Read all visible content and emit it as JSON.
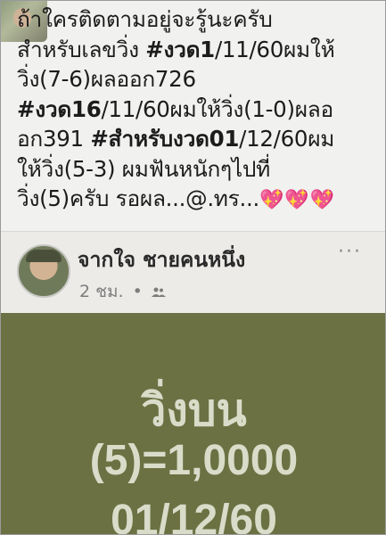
{
  "post": {
    "lines": [
      "ถ้าใครติดตามอยู่จะรู้นะครับ",
      "สำหรับเลขวิ่ง ",
      "วิ่ง(7-6)ผลออก726",
      "",
      "อก391 ",
      "ให้วิ่ง(5-3) ผมฟันหนักๆไปที่",
      "วิ่ง(5)ครับ รอผล...@.ทร..."
    ],
    "line2_bold": "#งวด1",
    "line2_rest": "/11/60ผมให้",
    "line4_bold": "#งวด16",
    "line4_rest": "/11/60ผมให้วิ่ง(1-0)ผลอ",
    "line5_bold": "#สำหรับงวด01",
    "line5_rest": "/12/60ผม",
    "hearts": "💖💖💖"
  },
  "author": {
    "name": "จากใจ ชายคนหนึ่ง",
    "time": "2 ชม.",
    "dot": "•",
    "more": "···"
  },
  "image": {
    "line1": "วิ่งบน",
    "line2": "(5)=1,0000",
    "line3": "01/12/60"
  },
  "colors": {
    "panel_green": "#6b7142",
    "panel_text": "#d9dcc9",
    "heart": "#d66c8e"
  }
}
